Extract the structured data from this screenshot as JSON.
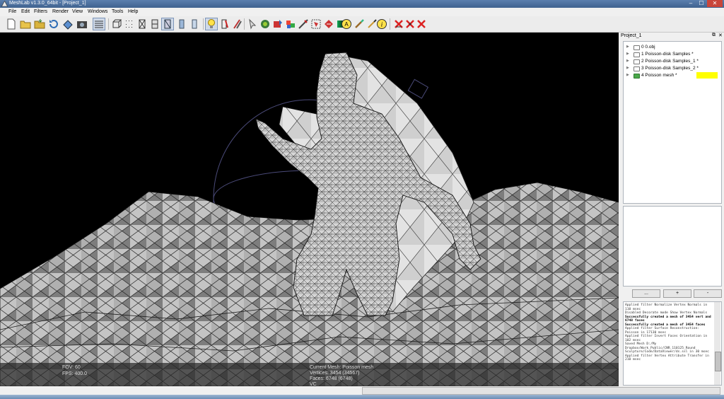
{
  "window": {
    "title": "MeshLab v1.3.0_64bit - [Project_1]",
    "minimize": "–",
    "maximize": "☐",
    "close": "✕"
  },
  "menu": [
    "File",
    "Edit",
    "Filters",
    "Render",
    "View",
    "Windows",
    "Tools",
    "Help"
  ],
  "toolbar": {
    "icons": [
      "new-project",
      "open-project",
      "save-project",
      "reload",
      "export",
      "snapshot",
      "layers-panel",
      "bbox-render",
      "points-render",
      "wireframe-render",
      "hidden-lines-render",
      "flat-render",
      "smooth-render",
      "texture-render",
      "light",
      "flat-shading",
      "colorize",
      "pick",
      "align",
      "move",
      "measure",
      "select-faces",
      "select-vertices",
      "paint-brush",
      "annotation",
      "texture-paint",
      "info",
      "delete-faces",
      "delete-vertices",
      "delete-all"
    ],
    "active": [
      "layers-panel",
      "wireframe-render",
      "light"
    ]
  },
  "viewport": {
    "fov_label": "FOV: 60",
    "fps_label": "FPS:   400.0",
    "current_mesh": "Current Mesh: Poisson mesh",
    "vertices": "Vertices: 3454 (34567)",
    "faces": "Faces: 6748 (6748)",
    "vc": "VC"
  },
  "panel": {
    "title": "Project_1",
    "float_icon": "⧉",
    "close_icon": "✕",
    "layers": [
      {
        "label": "0  0.obj",
        "visible": false,
        "highlight": false
      },
      {
        "label": "1  Poisson-disk Samples *",
        "visible": false,
        "highlight": false
      },
      {
        "label": "2  Poisson-disk Samples_1 *",
        "visible": false,
        "highlight": false
      },
      {
        "label": "3  Poisson-disk Samples_2 *",
        "visible": false,
        "highlight": false
      },
      {
        "label": "4  Poisson mesh *",
        "visible": true,
        "highlight": true
      }
    ],
    "buttons": {
      "more": "...",
      "plus": "+",
      "minus": "-"
    }
  },
  "log": [
    {
      "text": "Applied filter Normalize Vertex Normals in 110 msec",
      "bold": false
    },
    {
      "text": "Disabled Decorate mode Show Vertex Normals",
      "bold": false
    },
    {
      "text": "Successfully created a mesh of 3454 vert and 6748 faces",
      "bold": true
    },
    {
      "text": "Successfully created a mesh of 3454 faces",
      "bold": true
    },
    {
      "text": "Applied filter Surface Reconstruction: Poisson in 17130 msec",
      "bold": false
    },
    {
      "text": "Applied filter Invert Faces Orientation in 102 msec",
      "bold": false
    },
    {
      "text": "Saved Mesh D:/My Dropbox/Work_Public/CNR_110125_Round Sculpture/Code/DataViewer/ds.ssl in 30 msec",
      "bold": false
    },
    {
      "text": "Applied filter Vertex Attribute Transfer in 210 msec",
      "bold": false
    }
  ],
  "colors": {
    "title_bar": "#4a6d9c",
    "layer_highlight": "#ffff00",
    "viewport_bg": "#000000"
  }
}
